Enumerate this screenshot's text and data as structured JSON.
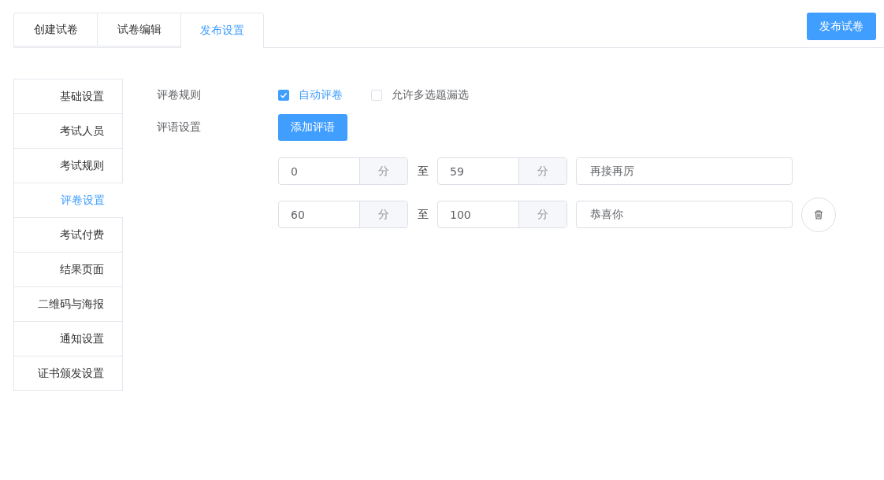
{
  "tabs": [
    {
      "label": "创建试卷",
      "selected": false
    },
    {
      "label": "试卷编辑",
      "selected": false
    },
    {
      "label": "发布设置",
      "selected": true
    }
  ],
  "publish_button": "发布试卷",
  "sidebar": {
    "items": [
      {
        "label": "基础设置",
        "selected": false
      },
      {
        "label": "考试人员",
        "selected": false
      },
      {
        "label": "考试规则",
        "selected": false
      },
      {
        "label": "评卷设置",
        "selected": true
      },
      {
        "label": "考试付费",
        "selected": false
      },
      {
        "label": "结果页面",
        "selected": false
      },
      {
        "label": "二维码与海报",
        "selected": false
      },
      {
        "label": "通知设置",
        "selected": false
      },
      {
        "label": "证书颁发设置",
        "selected": false
      }
    ]
  },
  "grading_rules": {
    "label": "评卷规则",
    "options": [
      {
        "label": "自动评卷",
        "checked": true
      },
      {
        "label": "允许多选题漏选",
        "checked": false
      }
    ]
  },
  "comments": {
    "label": "评语设置",
    "add_button": "添加评语",
    "rows": [
      {
        "from": "0",
        "from_unit": "分",
        "to_word": "至",
        "to": "59",
        "to_unit": "分",
        "comment": "再接再厉",
        "deletable": false
      },
      {
        "from": "60",
        "from_unit": "分",
        "to_word": "至",
        "to": "100",
        "to_unit": "分",
        "comment": "恭喜你",
        "deletable": true
      }
    ]
  }
}
